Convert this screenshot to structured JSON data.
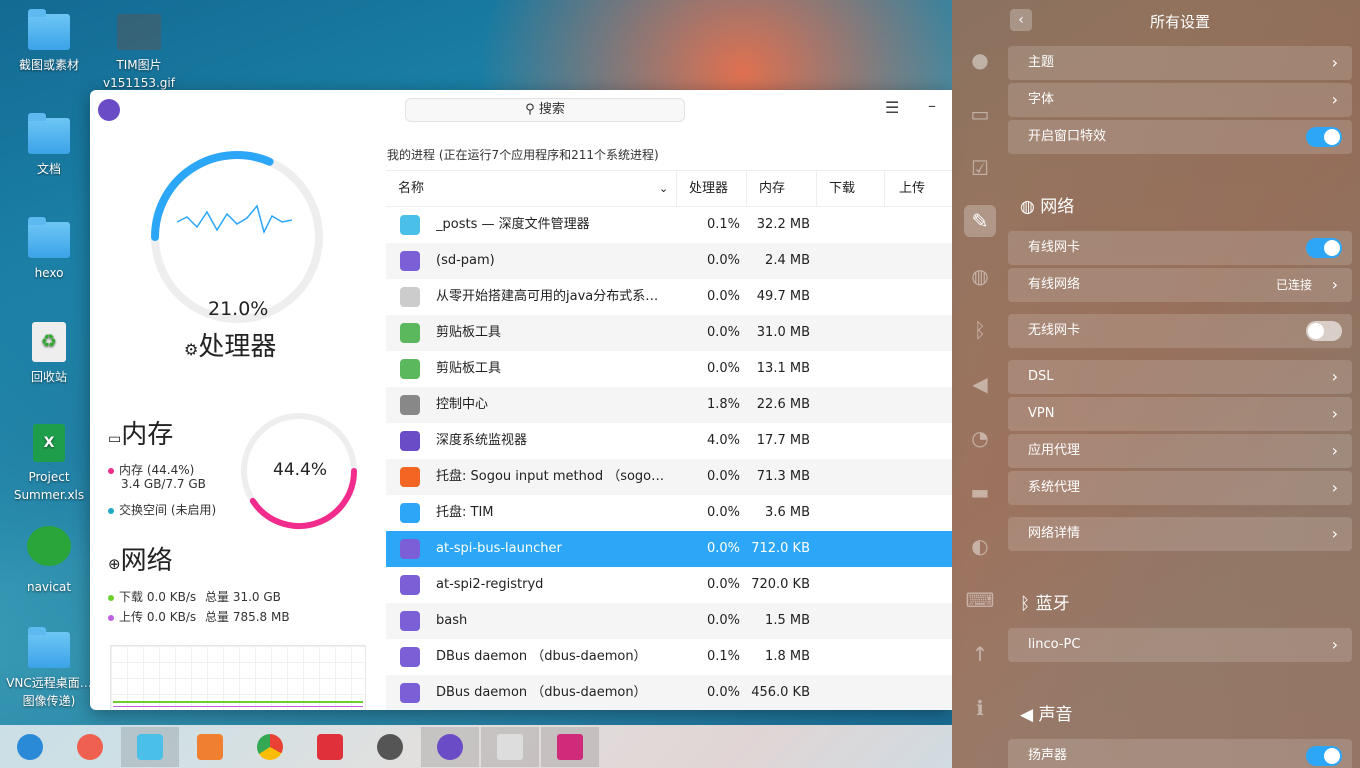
{
  "desktop": {
    "icons": [
      {
        "label": "截图或素材"
      },
      {
        "label": "TIM图片"
      },
      {
        "label": "文档"
      },
      {
        "label": "hexo"
      },
      {
        "label": "回收站"
      },
      {
        "label": "Project Summer.xls"
      },
      {
        "label": "navicat"
      },
      {
        "label": "VNC远程桌面…图像传递)"
      }
    ],
    "tim_sub": "v151153.gif"
  },
  "monitor": {
    "search_label": "搜索",
    "cpu": {
      "value": "21.0%",
      "label": "处理器",
      "fraction": 0.21
    },
    "mem": {
      "title": "内存",
      "value": "44.4%",
      "fraction": 0.444,
      "line1": "内存 (44.4%)",
      "line2": "3.4 GB/7.7 GB",
      "swap": "交换空间 (未启用)"
    },
    "net": {
      "title": "网络",
      "down": "下载 0.0 KB/s",
      "down_total": "总量 31.0 GB",
      "up": "上传 0.0 KB/s",
      "up_total": "总量 785.8 MB"
    },
    "process_header": "我的进程 (正在运行7个应用程序和211个系统进程)",
    "columns": {
      "name": "名称",
      "cpu": "处理器",
      "mem": "内存",
      "down": "下载",
      "up": "上传"
    },
    "rows": [
      {
        "name": "_posts — 深度文件管理器",
        "cpu": "0.1%",
        "mem": "32.2 MB",
        "icon": "folder-app-icon"
      },
      {
        "name": "(sd-pam)",
        "cpu": "0.0%",
        "mem": "2.4 MB",
        "icon": "process-gear-icon"
      },
      {
        "name": "从零开始搭建高可用的java分布式系…",
        "cpu": "0.0%",
        "mem": "49.7 MB",
        "icon": "text-editor-icon"
      },
      {
        "name": "剪贴板工具",
        "cpu": "0.0%",
        "mem": "31.0 MB",
        "icon": "clipboard-icon"
      },
      {
        "name": "剪贴板工具",
        "cpu": "0.0%",
        "mem": "13.1 MB",
        "icon": "clipboard-icon"
      },
      {
        "name": "控制中心",
        "cpu": "1.8%",
        "mem": "22.6 MB",
        "icon": "control-center-icon"
      },
      {
        "name": "深度系统监视器",
        "cpu": "4.0%",
        "mem": "17.7 MB",
        "icon": "system-monitor-icon"
      },
      {
        "name": "托盘: Sogou input method （sogo…",
        "cpu": "0.0%",
        "mem": "71.3 MB",
        "icon": "sogou-icon"
      },
      {
        "name": "托盘: TIM",
        "cpu": "0.0%",
        "mem": "3.6 MB",
        "icon": "tim-icon"
      },
      {
        "name": "at-spi-bus-launcher",
        "cpu": "0.0%",
        "mem": "712.0 KB",
        "icon": "process-gear-icon"
      },
      {
        "name": "at-spi2-registryd",
        "cpu": "0.0%",
        "mem": "720.0 KB",
        "icon": "process-gear-icon"
      },
      {
        "name": "bash",
        "cpu": "0.0%",
        "mem": "1.5 MB",
        "icon": "process-gear-icon"
      },
      {
        "name": "DBus daemon （dbus-daemon）",
        "cpu": "0.1%",
        "mem": "1.8 MB",
        "icon": "process-gear-icon"
      },
      {
        "name": "DBus daemon （dbus-daemon）",
        "cpu": "0.0%",
        "mem": "456.0 KB",
        "icon": "process-gear-icon"
      }
    ]
  },
  "settings": {
    "title": "所有设置",
    "theme": "主题",
    "font": "字体",
    "window_effects": "开启窗口特效",
    "network": "网络",
    "wired_card": "有线网卡",
    "wired_net": "有线网络",
    "wired_status": "已连接",
    "wireless_card": "无线网卡",
    "dsl": "DSL",
    "vpn": "VPN",
    "app_proxy": "应用代理",
    "sys_proxy": "系统代理",
    "net_details": "网络详情",
    "bluetooth": "蓝牙",
    "device": "linco-PC",
    "sound": "声音",
    "speaker": "扬声器"
  }
}
